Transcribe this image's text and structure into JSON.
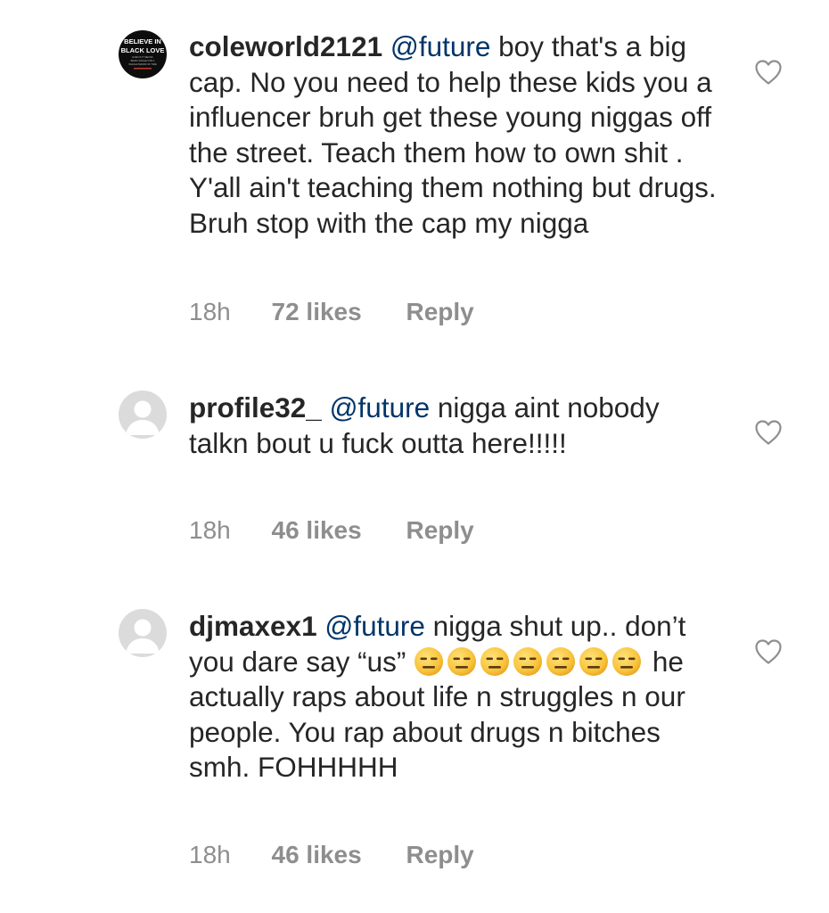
{
  "comments": [
    {
      "username": "coleworld2121",
      "mention": "@future",
      "text": " boy that's a big cap. No you need to help these kids you a influencer bruh get these young niggas off the street. Teach them how to own shit . Y'all ain't teaching them nothing but drugs. Bruh stop with the cap my nigga",
      "time": "18h",
      "likes": "72 likes",
      "reply": "Reply",
      "avatar": {
        "type": "logo",
        "lines": [
          "BELIEVE IN",
          "BLACK LOVE"
        ],
        "small_text": [
          "EVEN IF IT MEANS",
          "BEING SINGLE FOR A",
          "WHOLE PERIOD OF TIME"
        ]
      }
    },
    {
      "username": "profile32_",
      "mention": "@future",
      "text": " nigga aint nobody talkn bout u fuck outta here!!!!!",
      "time": "18h",
      "likes": "46 likes",
      "reply": "Reply",
      "avatar": {
        "type": "default"
      }
    },
    {
      "username": "djmaxex1",
      "mention": "@future",
      "text_before": " nigga shut up.. don’t you dare say “us” ",
      "text_after": " he actually raps about life n struggles n our people. You rap about drugs n bitches smh. FOHHHHH",
      "emoji_group_1": [
        "expressionless-face",
        "expressionless-face",
        "expressionless-face"
      ],
      "emoji_group_2": [
        "expressionless-face",
        "expressionless-face",
        "expressionless-face",
        "expressionless-face"
      ],
      "time": "18h",
      "likes": "46 likes",
      "reply": "Reply",
      "avatar": {
        "type": "default"
      }
    }
  ],
  "colors": {
    "text": "#262626",
    "mention": "#003569",
    "meta": "#8e8e8e",
    "heart": "#8e8e8e",
    "avatar_default": "#dbdbdb"
  },
  "icons": {
    "like": "heart-outline-icon",
    "default_avatar": "user-silhouette-icon",
    "emoji": "expressionless-face-emoji"
  }
}
